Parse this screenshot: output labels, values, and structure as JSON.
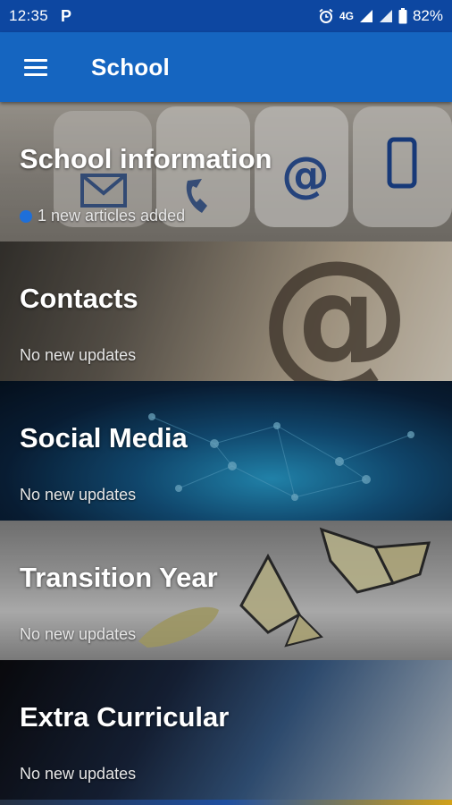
{
  "status_bar": {
    "time": "12:35",
    "network": "4G",
    "battery": "82%"
  },
  "app_bar": {
    "title": "School"
  },
  "cards": [
    {
      "title": "School information",
      "subtitle": "1 new articles added",
      "has_new": true
    },
    {
      "title": "Contacts",
      "subtitle": "No new updates",
      "has_new": false
    },
    {
      "title": "Social Media",
      "subtitle": "No new updates",
      "has_new": false
    },
    {
      "title": "Transition Year",
      "subtitle": "No new updates",
      "has_new": false
    },
    {
      "title": "Extra Curricular",
      "subtitle": "No new updates",
      "has_new": false
    }
  ],
  "colors": {
    "status_bar": "#0d47a1",
    "app_bar": "#1565c0",
    "new_dot": "#1e6fd9"
  },
  "icons": [
    "menu-icon",
    "parking-icon",
    "alarm-icon",
    "signal-icon",
    "battery-icon",
    "mail-icon",
    "phone-icon",
    "at-sign-icon",
    "mobile-phone-icon"
  ]
}
